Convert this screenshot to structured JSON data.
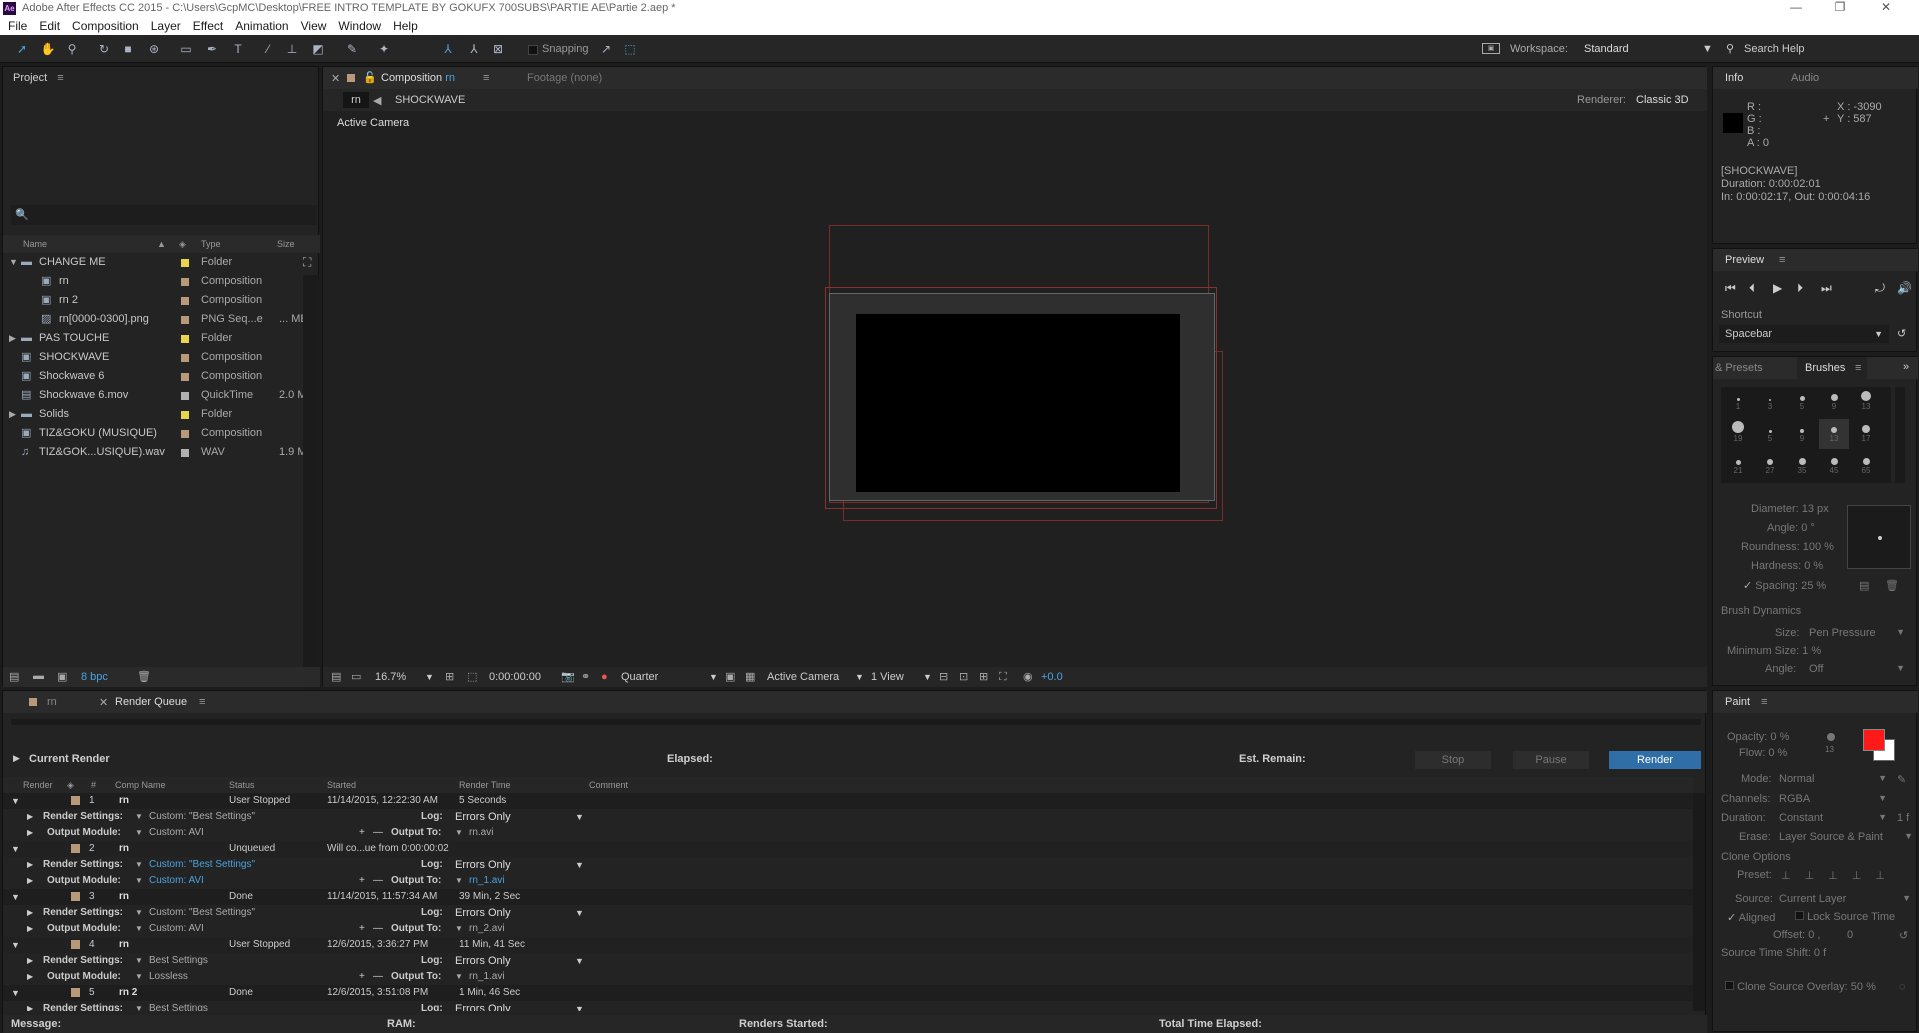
{
  "titlebar": {
    "title": "Adobe After Effects CC 2015 - C:\\Users\\GcpMC\\Desktop\\FREE INTRO TEMPLATE BY GOKUFX 700SUBS\\PARTIE AE\\Partie 2.aep *",
    "app_badge": "Ae",
    "min": "—",
    "max": "❐",
    "close": "✕"
  },
  "menu": [
    "File",
    "Edit",
    "Composition",
    "Layer",
    "Effect",
    "Animation",
    "View",
    "Window",
    "Help"
  ],
  "toolbar": {
    "snapping": "Snapping",
    "workspace_label": "Workspace:",
    "workspace_value": "Standard",
    "search_help": "Search Help"
  },
  "project": {
    "tab": "Project",
    "search_icon": "🔍",
    "columns": {
      "name": "Name",
      "type": "Type",
      "size": "Size"
    },
    "items": [
      {
        "name": "CHANGE ME",
        "type": "Folder",
        "size": "",
        "color": "#e8d44d",
        "indent": 0,
        "icon": "folder",
        "twirl": "▼"
      },
      {
        "name": "rn",
        "type": "Composition",
        "size": "",
        "color": "#b89a7a",
        "indent": 1,
        "icon": "comp",
        "twirl": ""
      },
      {
        "name": "rn 2",
        "type": "Composition",
        "size": "",
        "color": "#b89a7a",
        "indent": 1,
        "icon": "comp",
        "twirl": ""
      },
      {
        "name": "rn[0000-0300].png",
        "type": "PNG Seq...e",
        "size": "... ME",
        "color": "#b89a7a",
        "indent": 1,
        "icon": "img",
        "twirl": ""
      },
      {
        "name": "PAS TOUCHE",
        "type": "Folder",
        "size": "",
        "color": "#e8d44d",
        "indent": 0,
        "icon": "folder",
        "twirl": "▶"
      },
      {
        "name": "SHOCKWAVE",
        "type": "Composition",
        "size": "",
        "color": "#b89a7a",
        "indent": 0,
        "icon": "comp",
        "twirl": ""
      },
      {
        "name": "Shockwave 6",
        "type": "Composition",
        "size": "",
        "color": "#b89a7a",
        "indent": 0,
        "icon": "comp",
        "twirl": ""
      },
      {
        "name": "Shockwave 6.mov",
        "type": "QuickTime",
        "size": "2.0 M",
        "color": "#b0b0b0",
        "indent": 0,
        "icon": "file",
        "twirl": ""
      },
      {
        "name": "Solids",
        "type": "Folder",
        "size": "",
        "color": "#e8d44d",
        "indent": 0,
        "icon": "folder",
        "twirl": "▶"
      },
      {
        "name": "TIZ&GOKU (MUSIQUE)",
        "type": "Composition",
        "size": "",
        "color": "#b89a7a",
        "indent": 0,
        "icon": "comp",
        "twirl": ""
      },
      {
        "name": "TIZ&GOK...USIQUE).wav",
        "type": "WAV",
        "size": "1.9 M",
        "color": "#b0b0b0",
        "indent": 0,
        "icon": "audio",
        "twirl": ""
      }
    ],
    "bpc": "8 bpc"
  },
  "comp": {
    "tab": "Composition",
    "tab_name": "rn",
    "footage_tab": "Footage (none)",
    "breadcrumb_current": "rn",
    "breadcrumb_next": "SHOCKWAVE",
    "renderer_label": "Renderer:",
    "renderer_value": "Classic 3D",
    "active_camera": "Active Camera",
    "footer": {
      "zoom": "16.7%",
      "timecode": "0:00:00:00",
      "resolution": "Quarter",
      "view": "Active Camera",
      "layout": "1 View",
      "exposure": "+0.0"
    }
  },
  "info": {
    "tab": "Info",
    "audio_tab": "Audio",
    "r": "R :",
    "g": "G :",
    "b": "B :",
    "a": "A : 0",
    "x": "X : -3090",
    "y": "Y : 587",
    "layer": "[SHOCKWAVE]",
    "duration": "Duration: 0:00:02:01",
    "inout": "In: 0:00:02:17, Out: 0:00:04:16"
  },
  "preview": {
    "tab": "Preview",
    "shortcut_label": "Shortcut",
    "shortcut_value": "Spacebar"
  },
  "brushes": {
    "presets_tab": "& Presets",
    "tab": "Brushes",
    "sizes": [
      "1",
      "3",
      "5",
      "9",
      "13",
      "19",
      "5",
      "9",
      "13",
      "17",
      "21",
      "27",
      "35",
      "45",
      "65"
    ],
    "diameter": "Diameter: 13 px",
    "angle": "Angle: 0 °",
    "roundness": "Roundness: 100 %",
    "hardness": "Hardness: 0 %",
    "spacing": "Spacing: 25 %",
    "dynamics": "Brush Dynamics",
    "size_label": "Size:",
    "size_value": "Pen Pressure",
    "min_size": "Minimum Size: 1 %",
    "angle_label": "Angle:",
    "angle_value": "Off"
  },
  "paint": {
    "tab": "Paint",
    "opacity": "Opacity: 0 %",
    "flow": "Flow: 0 %",
    "flow_num": "13",
    "mode_label": "Mode:",
    "mode_value": "Normal",
    "channels_label": "Channels:",
    "channels_value": "RGBA",
    "duration_label": "Duration:",
    "duration_value": "Constant",
    "duration_frames": "1 f",
    "erase_label": "Erase:",
    "erase_value": "Layer Source & Paint",
    "clone_options": "Clone Options",
    "preset_label": "Preset:",
    "source_label": "Source:",
    "source_value": "Current Layer",
    "aligned": "Aligned",
    "lock_source": "Lock Source Time",
    "offset": "Offset: 0 ,",
    "offset_y": "0",
    "shift": "Source Time Shift: 0 f",
    "overlay": "Clone Source Overlay: 50 %",
    "fg_color": "#ff1a1a",
    "bg_color": "#ffffff"
  },
  "renderq": {
    "tab_rn": "rn",
    "tab": "Render Queue",
    "current_render": "Current Render",
    "elapsed": "Elapsed:",
    "est_remain": "Est. Remain:",
    "stop": "Stop",
    "pause": "Pause",
    "render": "Render",
    "columns": [
      "Render",
      "#",
      "Comp Name",
      "Status",
      "Started",
      "Render Time",
      "Comment"
    ],
    "items": [
      {
        "num": "1",
        "comp": "rn",
        "status": "User Stopped",
        "started": "11/14/2015, 12:22:30 AM",
        "time": "5 Seconds",
        "settings": "Custom: \"Best Settings\"",
        "module": "Custom: AVI",
        "output": "rn.avi",
        "log": "Errors Only",
        "highlight": false
      },
      {
        "num": "2",
        "comp": "rn",
        "status": "Unqueued",
        "started": "Will co...ue from 0:00:00:02",
        "time": "",
        "settings": "Custom: \"Best Settings\"",
        "module": "Custom: AVI",
        "output": "rn_1.avi",
        "log": "Errors Only",
        "highlight": true
      },
      {
        "num": "3",
        "comp": "rn",
        "status": "Done",
        "started": "11/14/2015, 11:57:34 AM",
        "time": "39 Min, 2 Sec",
        "settings": "Custom: \"Best Settings\"",
        "module": "Custom: AVI",
        "output": "rn_2.avi",
        "log": "Errors Only",
        "highlight": false
      },
      {
        "num": "4",
        "comp": "rn",
        "status": "User Stopped",
        "started": "12/6/2015, 3:36:27 PM",
        "time": "11 Min, 41 Sec",
        "settings": "Best Settings",
        "module": "Lossless",
        "output": "rn_1.avi",
        "log": "Errors Only",
        "highlight": false
      },
      {
        "num": "5",
        "comp": "rn 2",
        "status": "Done",
        "started": "12/6/2015, 3:51:08 PM",
        "time": "1 Min, 46 Sec",
        "settings": "Best Settings",
        "module": "",
        "output": "",
        "log": "Errors Only",
        "highlight": false
      }
    ],
    "labels": {
      "render_settings": "Render Settings:",
      "output_module": "Output Module:",
      "log": "Log:",
      "output_to": "Output To:"
    },
    "footer": {
      "message": "Message:",
      "ram": "RAM:",
      "renders_started": "Renders Started:",
      "total_elapsed": "Total Time Elapsed:"
    }
  }
}
